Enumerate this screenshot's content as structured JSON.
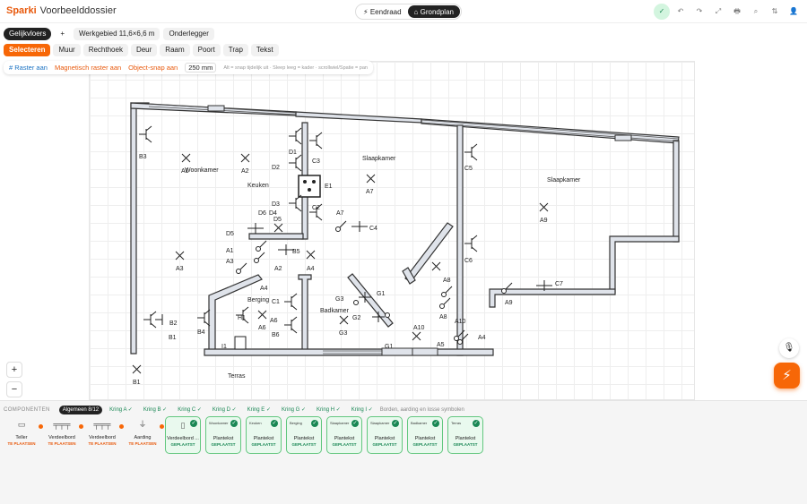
{
  "app": {
    "brand": "Sparki",
    "document": "Voorbeelddossier"
  },
  "view_toggle": {
    "options": [
      "⚡ Eendraad",
      "⌂ Grondplan"
    ],
    "active": 1
  },
  "toolbar_icons": [
    "✓",
    "↶",
    "↷",
    "⤢",
    "🖶",
    "⌕",
    "⇅",
    "👤"
  ],
  "floor_row": {
    "floor": "Gelijkvloers",
    "add": "+",
    "workarea": "Werkgebied 11,6×6,6 m",
    "underlay": "Onderlegger"
  },
  "tools": [
    "Selecteren",
    "Muur",
    "Rechthoek",
    "Deur",
    "Raam",
    "Poort",
    "Trap",
    "Tekst"
  ],
  "snap": {
    "grid": "# Raster aan",
    "magnetic": "Magnetisch raster aan",
    "object": "Object-snap aan",
    "step": "250 mm",
    "hint": "Alt = snap tijdelijk uit · Sleep leeg = kader · scrollwiel/Spatie = pan"
  },
  "rooms": [
    "Slaapkamer",
    "Keuken",
    "Woonkamer",
    "Slaapkamer",
    "Berging",
    "Badkamer",
    "Terras"
  ],
  "labels": [
    "B3",
    "A1",
    "A2",
    "D1",
    "C3",
    "D2",
    "E1",
    "A7",
    "C5",
    "A9",
    "D3",
    "C2",
    "D6",
    "D4",
    "D5",
    "A7",
    "C4",
    "D5",
    "A1",
    "B5",
    "A3",
    "A2",
    "A4",
    "A3",
    "A6",
    "A4",
    "C1",
    "H1",
    "A6",
    "B4",
    "B6",
    "G3",
    "G1",
    "G2",
    "C6",
    "A8",
    "A8",
    "A9",
    "C7",
    "A10",
    "A10",
    "A5",
    "A4",
    "B2",
    "B1",
    "I1",
    "G3",
    "G1",
    "B1"
  ],
  "zoom": {
    "in": "+",
    "out": "−"
  },
  "fab": {
    "mic": "🎙",
    "bolt": "⚡"
  },
  "bottom": {
    "section": "COMPONENTEN",
    "tabs": [
      "Algemeen 8/12",
      "Kring A ✓",
      "Kring B ✓",
      "Kring C ✓",
      "Kring D ✓",
      "Kring E ✓",
      "Kring G ✓",
      "Kring H ✓",
      "Kring I ✓"
    ],
    "note": "Borden, aarding en losse symbolen",
    "cards": [
      {
        "name": "Teller",
        "status": "TE PLAATSEN",
        "icon": "▭"
      },
      {
        "name": "Verdeelbord",
        "status": "TE PLAATSEN",
        "icon": "╤╤╤"
      },
      {
        "name": "Verdeelbord",
        "status": "TE PLAATSEN",
        "icon": "╤╤╤"
      },
      {
        "name": "Aarding",
        "status": "TE PLAATSEN",
        "icon": "⏚"
      },
      {
        "name": "Verdeelbord ...",
        "status": "GEPLAATST",
        "icon": "▯"
      },
      {
        "name": "Plantekst",
        "status": "GEPLAATST",
        "small": "Woonkamer"
      },
      {
        "name": "Plantekst",
        "status": "GEPLAATST",
        "small": "Keuken"
      },
      {
        "name": "Plantekst",
        "status": "GEPLAATST",
        "small": "Berging"
      },
      {
        "name": "Plantekst",
        "status": "GEPLAATST",
        "small": "Slaapkamer"
      },
      {
        "name": "Plantekst",
        "status": "GEPLAATST",
        "small": "Slaapkamer"
      },
      {
        "name": "Plantekst",
        "status": "GEPLAATST",
        "small": "Badkamer"
      },
      {
        "name": "Plantekst",
        "status": "GEPLAATST",
        "small": "Terras"
      }
    ]
  }
}
